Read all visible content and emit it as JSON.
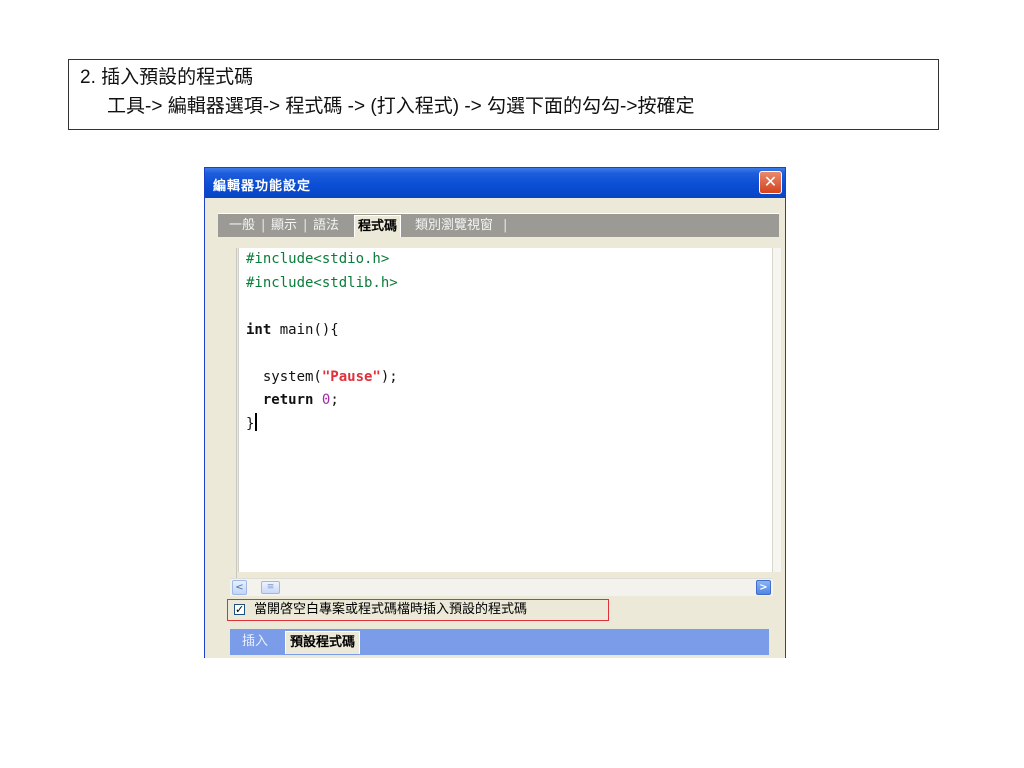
{
  "instruction": {
    "line1": "2. 插入預設的程式碼",
    "line2": "工具-> 編輯器選項-> 程式碼 -> (打入程式) -> 勾選下面的勾勾->按確定"
  },
  "dialog": {
    "title": "編輯器功能設定",
    "close_glyph": "✕",
    "tabs": [
      {
        "label": "一般",
        "active": false
      },
      {
        "label": "顯示",
        "active": false
      },
      {
        "label": "語法",
        "active": false
      },
      {
        "label": "程式碼",
        "active": true
      },
      {
        "label": "類別瀏覽視窗",
        "active": false
      }
    ],
    "tab_separator": "|",
    "code": {
      "line1": "#include<stdio.h>",
      "line2": "#include<stdlib.h>",
      "line3_kw": "int",
      "line3_rest": " main(){",
      "line4_pre": "  system(",
      "line4_str": "\"Pause\"",
      "line4_post": ");",
      "line5_kw": "return",
      "line5_num": "0",
      "line5_post": ";",
      "line6": "}"
    },
    "scroll": {
      "left_glyph": "<",
      "right_glyph": ">",
      "thumb_glyph": "≡"
    },
    "checkbox": {
      "checked": true,
      "check_glyph": "✓",
      "label": "當開啓空白專案或程式碼檔時插入預設的程式碼"
    },
    "bottom_tabs": [
      {
        "label": "插入",
        "active": false
      },
      {
        "label": "預設程式碼",
        "active": true
      }
    ]
  }
}
